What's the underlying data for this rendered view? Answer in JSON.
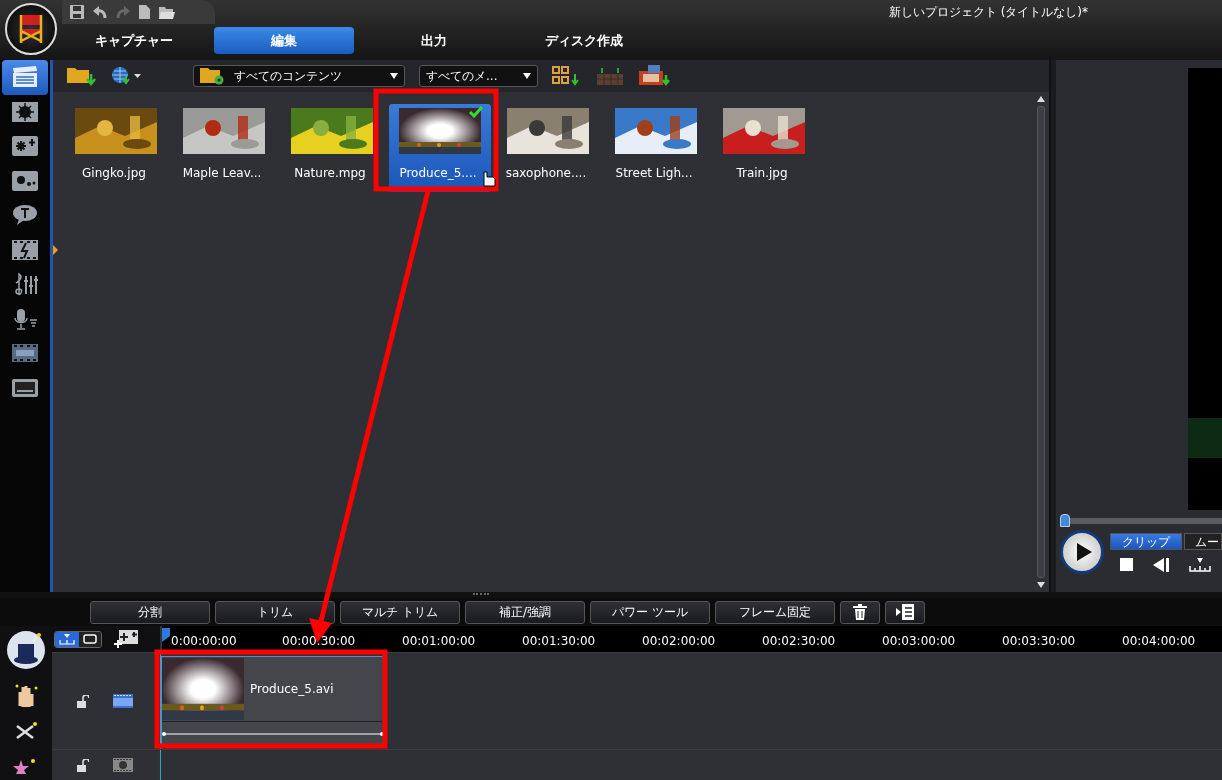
{
  "window": {
    "title": "新しいプロジェクト (タイトルなし)*"
  },
  "tabs": [
    {
      "label": "キャプチャー",
      "selected": false
    },
    {
      "label": "編集",
      "selected": true
    },
    {
      "label": "出力",
      "selected": false
    },
    {
      "label": "ディスク作成",
      "selected": false
    }
  ],
  "sidebar": {
    "items": [
      {
        "kind": "media",
        "selected": true
      },
      {
        "kind": "effect",
        "selected": false
      },
      {
        "kind": "pip",
        "selected": false
      },
      {
        "kind": "particle",
        "selected": false
      },
      {
        "kind": "title",
        "selected": false
      },
      {
        "kind": "transition",
        "selected": false
      },
      {
        "kind": "audio",
        "selected": false
      },
      {
        "kind": "voice",
        "selected": false
      },
      {
        "kind": "chapter",
        "selected": false
      },
      {
        "kind": "subtitle",
        "selected": false
      }
    ]
  },
  "library": {
    "filter": "すべてのコンテンツ",
    "sort": "すべてのメ...",
    "items": [
      {
        "name": "Gingko.jpg",
        "selected": false,
        "checked": false
      },
      {
        "name": "Maple Leav...",
        "selected": false,
        "checked": false
      },
      {
        "name": "Nature.mpg",
        "selected": false,
        "checked": false
      },
      {
        "name": "Produce_5....",
        "selected": true,
        "checked": true
      },
      {
        "name": "saxophone....",
        "selected": false,
        "checked": false
      },
      {
        "name": "Street Ligh...",
        "selected": false,
        "checked": false
      },
      {
        "name": "Train.jpg",
        "selected": false,
        "checked": false
      }
    ]
  },
  "preview": {
    "level": 0,
    "tabs": [
      {
        "label": "クリップ",
        "selected": true
      },
      {
        "label": "ムー",
        "selected": false
      }
    ]
  },
  "timeline": {
    "tools": [
      "分割",
      "トリム",
      "マルチ トリム",
      "補正/強調",
      "パワー ツール",
      "フレーム固定"
    ],
    "ticks": [
      "0:00:00:00",
      "00:00:30:00",
      "00:01:00:00",
      "00:01:30:00",
      "00:02:00:00",
      "00:02:30:00",
      "00:03:00:00",
      "00:03:30:00",
      "00:04:00:00"
    ],
    "tracks": [
      {
        "kind": "video",
        "clip": "Produce_5.avi"
      },
      {
        "kind": "effect"
      }
    ]
  }
}
